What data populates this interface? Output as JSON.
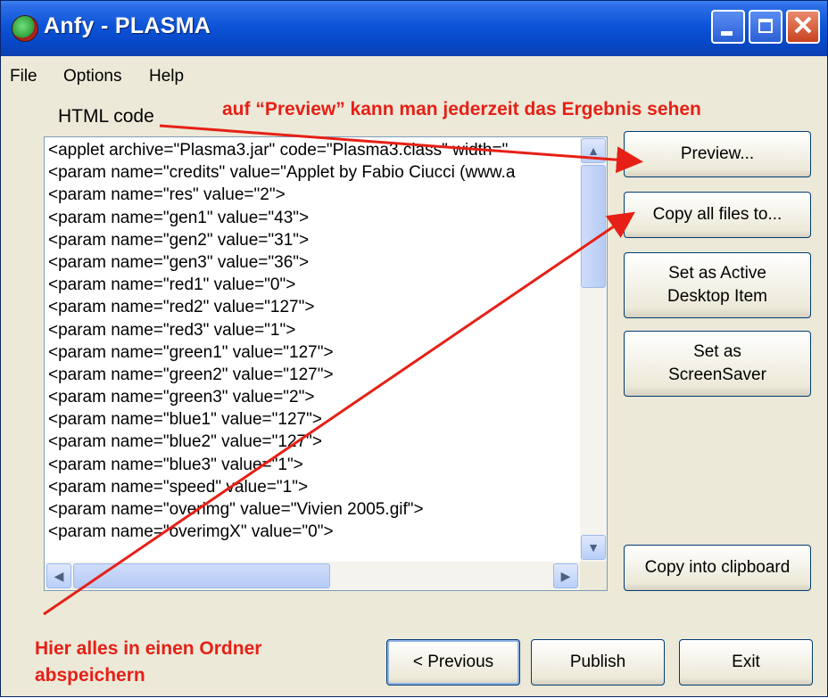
{
  "window": {
    "title": "Anfy - PLASMA",
    "app_icon": "plasma-app-icon",
    "controls": {
      "minimize_icon": "minimize-icon",
      "maximize_icon": "maximize-icon",
      "close_icon": "close-icon",
      "close_glyph": "✕"
    }
  },
  "menubar": {
    "items": [
      "File",
      "Options",
      "Help"
    ]
  },
  "html_label": "HTML code",
  "code_lines": [
    "<applet archive=\"Plasma3.jar\" code=\"Plasma3.class\" width=\"",
    "<param name=\"credits\" value=\"Applet by Fabio Ciucci (www.a",
    "<param name=\"res\" value=\"2\">",
    "<param name=\"gen1\" value=\"43\">",
    "<param name=\"gen2\" value=\"31\">",
    "<param name=\"gen3\" value=\"36\">",
    "<param name=\"red1\" value=\"0\">",
    "<param name=\"red2\" value=\"127\">",
    "<param name=\"red3\" value=\"1\">",
    "<param name=\"green1\" value=\"127\">",
    "<param name=\"green2\" value=\"127\">",
    "<param name=\"green3\" value=\"2\">",
    "<param name=\"blue1\" value=\"127\">",
    "<param name=\"blue2\" value=\"127\">",
    "<param name=\"blue3\" value=\"1\">",
    "<param name=\"speed\" value=\"1\">",
    "<param name=\"overimg\" value=\"Vivien 2005.gif\">",
    "<param name=\"overimgX\" value=\"0\">"
  ],
  "side_buttons": {
    "preview": "Preview...",
    "copy_files": "Copy all files to...",
    "active_desktop_line1": "Set as Active",
    "active_desktop_line2": "Desktop Item",
    "screensaver_line1": "Set as",
    "screensaver_line2": "ScreenSaver",
    "clipboard": "Copy into clipboard"
  },
  "bottom_buttons": {
    "previous": "< Previous",
    "publish": "Publish",
    "exit": "Exit"
  },
  "annotations": {
    "top": "auf “Preview” kann man jederzeit das Ergebnis sehen",
    "bottom_line1": "Hier alles in einen Ordner",
    "bottom_line2": "abspeichern"
  },
  "colors": {
    "titlebar": "#0a54d8",
    "window_bg": "#ece9d8",
    "annotation_red": "#e62016",
    "button_border": "#003c74"
  },
  "scrollbars": {
    "vertical_position": 0.0,
    "horizontal_position": 0.0
  }
}
